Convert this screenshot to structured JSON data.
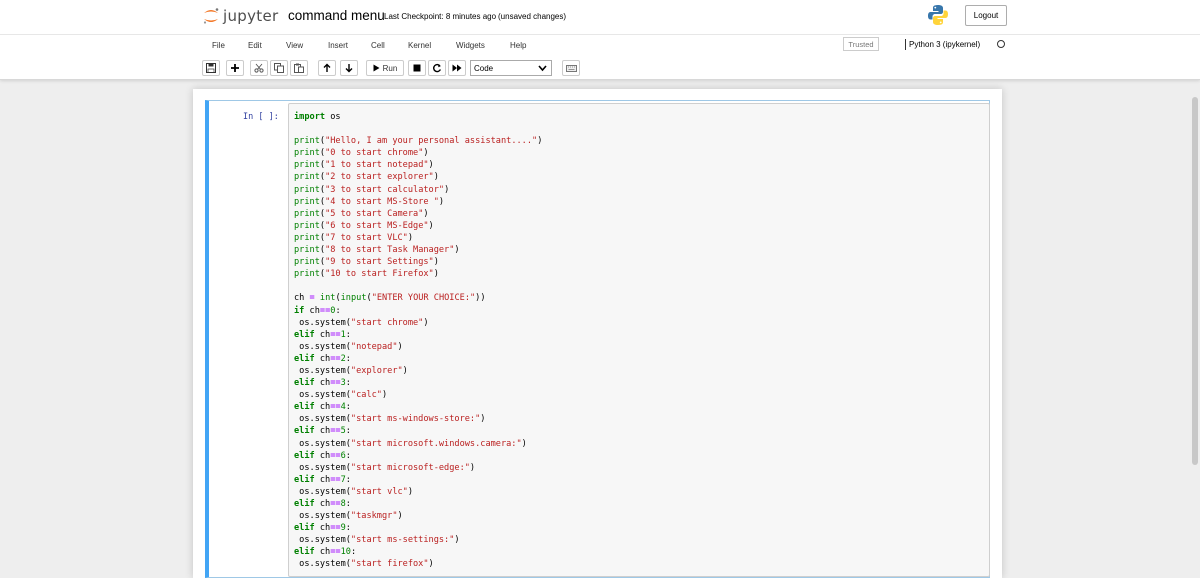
{
  "header": {
    "logo_text": "jupyter",
    "notebook_name": "command menu",
    "checkpoint": "Last Checkpoint: 8 minutes ago",
    "save_status": "(unsaved changes)",
    "logout_label": "Logout"
  },
  "menubar": {
    "items": [
      "File",
      "Edit",
      "View",
      "Insert",
      "Cell",
      "Kernel",
      "Widgets",
      "Help"
    ],
    "trusted_label": "Trusted",
    "kernel_name": "Python 3 (ipykernel)"
  },
  "toolbar": {
    "run_label": "Run",
    "cell_type": "Code",
    "icons": [
      "save-icon",
      "plus-icon",
      "cut-icon",
      "copy-icon",
      "paste-icon",
      "arrow-up-icon",
      "arrow-down-icon",
      "run-icon",
      "stop-icon",
      "restart-icon",
      "fast-forward-icon",
      "keyboard-icon"
    ]
  },
  "cell": {
    "prompt": "In [ ]:",
    "code_lines": [
      "import os",
      "",
      "print(\"Hello, I am your personal assistant....\")",
      "print(\"0 to start chrome\")",
      "print(\"1 to start notepad\")",
      "print(\"2 to start explorer\")",
      "print(\"3 to start calculator\")",
      "print(\"4 to start MS-Store \")",
      "print(\"5 to start Camera\")",
      "print(\"6 to start MS-Edge\")",
      "print(\"7 to start VLC\")",
      "print(\"8 to start Task Manager\")",
      "print(\"9 to start Settings\")",
      "print(\"10 to start Firefox\")",
      "",
      "ch = int(input(\"ENTER YOUR CHOICE:\"))",
      "if ch==0:",
      " os.system(\"start chrome\")",
      "elif ch==1:",
      " os.system(\"notepad\")",
      "elif ch==2:",
      " os.system(\"explorer\")",
      "elif ch==3:",
      " os.system(\"calc\")",
      "elif ch==4:",
      " os.system(\"start ms-windows-store:\")",
      "elif ch==5:",
      " os.system(\"start microsoft.windows.camera:\")",
      "elif ch==6:",
      " os.system(\"start microsoft-edge:\")",
      "elif ch==7:",
      " os.system(\"start vlc\")",
      "elif ch==8:",
      " os.system(\"taskmgr\")",
      "elif ch==9:",
      " os.system(\"start ms-settings:\")",
      "elif ch==10:",
      " os.system(\"start firefox\")"
    ]
  },
  "colors": {
    "accent": "#42a5f5",
    "prompt": "#303f9f",
    "keyword": "#008000",
    "string": "#ba2121",
    "operator": "#aa22ff",
    "logo_orange": "#f37726"
  }
}
